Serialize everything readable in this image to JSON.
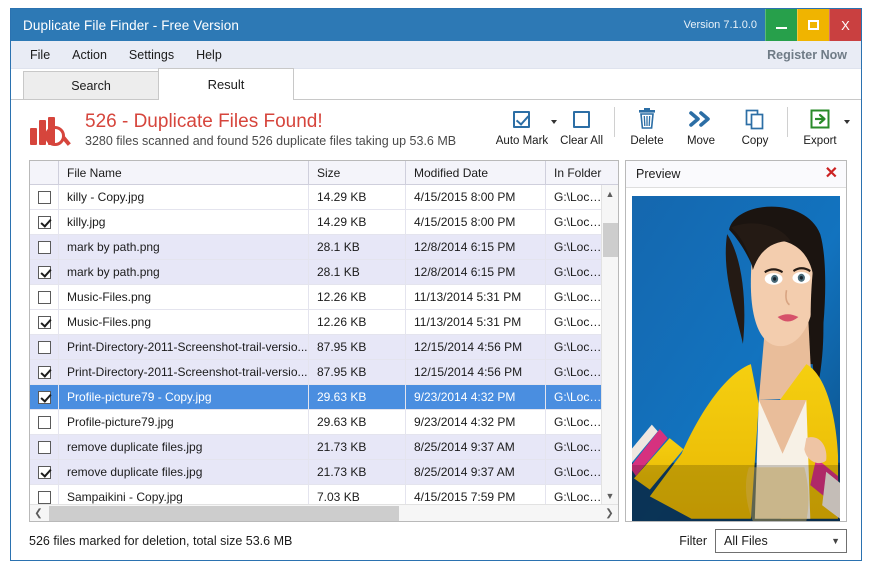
{
  "window": {
    "title": "Duplicate File Finder - Free Version",
    "version": "Version 7.1.0.0",
    "buttons": {
      "minimize": "–",
      "maximize": "□",
      "close": "X"
    },
    "accent_color": "#2d79b5"
  },
  "menu": {
    "items": [
      "File",
      "Action",
      "Settings",
      "Help"
    ],
    "register": "Register Now"
  },
  "tabs": [
    {
      "label": "Search",
      "active": false
    },
    {
      "label": "Result",
      "active": true
    }
  ],
  "header": {
    "title": "526 - Duplicate Files Found!",
    "subtitle": "3280 files scanned and found 526 duplicate files taking up 53.6 MB",
    "title_color": "#d6453c"
  },
  "toolbar": [
    {
      "label": "Auto Mark",
      "icon": "checkbox-checked-icon",
      "caret": true
    },
    {
      "label": "Clear All",
      "icon": "checkbox-empty-icon",
      "caret": false
    },
    {
      "label": "Delete",
      "icon": "trash-icon",
      "caret": false
    },
    {
      "label": "Move",
      "icon": "double-chevron-right-icon",
      "caret": false
    },
    {
      "label": "Copy",
      "icon": "copy-icon",
      "caret": false
    },
    {
      "label": "Export",
      "icon": "export-icon",
      "caret": true
    }
  ],
  "table": {
    "columns": [
      "",
      "File Name",
      "Size",
      "Modified Date",
      "In Folder"
    ],
    "rows": [
      {
        "checked": false,
        "name": "killy - Copy.jpg",
        "size": "14.29 KB",
        "date": "4/15/2015 8:00 PM",
        "folder": "G:\\Local Dis",
        "alt": false,
        "selected": false
      },
      {
        "checked": true,
        "name": "killy.jpg",
        "size": "14.29 KB",
        "date": "4/15/2015 8:00 PM",
        "folder": "G:\\Local Dis",
        "alt": false,
        "selected": false
      },
      {
        "checked": false,
        "name": "mark by path.png",
        "size": "28.1 KB",
        "date": "12/8/2014 6:15 PM",
        "folder": "G:\\Local Dis",
        "alt": true,
        "selected": false
      },
      {
        "checked": true,
        "name": "mark by path.png",
        "size": "28.1 KB",
        "date": "12/8/2014 6:15 PM",
        "folder": "G:\\Local Dis",
        "alt": true,
        "selected": false
      },
      {
        "checked": false,
        "name": "Music-Files.png",
        "size": "12.26 KB",
        "date": "11/13/2014 5:31 PM",
        "folder": "G:\\Local Dis",
        "alt": false,
        "selected": false
      },
      {
        "checked": true,
        "name": "Music-Files.png",
        "size": "12.26 KB",
        "date": "11/13/2014 5:31 PM",
        "folder": "G:\\Local Dis",
        "alt": false,
        "selected": false
      },
      {
        "checked": false,
        "name": "Print-Directory-2011-Screenshot-trail-versio...",
        "size": "87.95 KB",
        "date": "12/15/2014 4:56 PM",
        "folder": "G:\\Local Dis",
        "alt": true,
        "selected": false
      },
      {
        "checked": true,
        "name": "Print-Directory-2011-Screenshot-trail-versio...",
        "size": "87.95 KB",
        "date": "12/15/2014 4:56 PM",
        "folder": "G:\\Local Dis",
        "alt": true,
        "selected": false
      },
      {
        "checked": true,
        "name": "Profile-picture79 - Copy.jpg",
        "size": "29.63 KB",
        "date": "9/23/2014 4:32 PM",
        "folder": "G:\\Local Dis",
        "alt": false,
        "selected": true
      },
      {
        "checked": false,
        "name": "Profile-picture79.jpg",
        "size": "29.63 KB",
        "date": "9/23/2014 4:32 PM",
        "folder": "G:\\Local Dis",
        "alt": false,
        "selected": false
      },
      {
        "checked": false,
        "name": "remove duplicate files.jpg",
        "size": "21.73 KB",
        "date": "8/25/2014 9:37 AM",
        "folder": "G:\\Local Dis",
        "alt": true,
        "selected": false
      },
      {
        "checked": true,
        "name": "remove duplicate files.jpg",
        "size": "21.73 KB",
        "date": "8/25/2014 9:37 AM",
        "folder": "G:\\Local Dis",
        "alt": true,
        "selected": false
      },
      {
        "checked": false,
        "name": "Sampaikini - Copy.jpg",
        "size": "7.03 KB",
        "date": "4/15/2015 7:59 PM",
        "folder": "G:\\Local Dis",
        "alt": false,
        "selected": false
      }
    ]
  },
  "preview": {
    "title": "Preview",
    "close": "✕"
  },
  "footer": {
    "status": "526 files marked for deletion, total size 53.6 MB",
    "filter_label": "Filter",
    "filter_value": "All Files",
    "filter_caret": "⌄"
  }
}
